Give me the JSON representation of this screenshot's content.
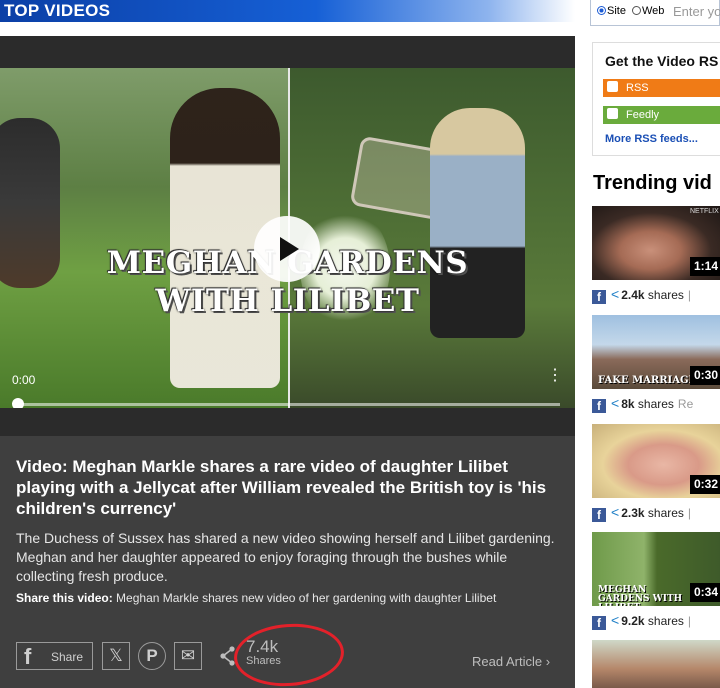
{
  "header": {
    "title": "TOP VIDEOS"
  },
  "player": {
    "overlay_line1": "MEGHAN GARDENS",
    "overlay_line2": "WITH LILIBET",
    "time": "0:00",
    "progress_fraction": 0
  },
  "video_info": {
    "title": "Video: Meghan Markle shares a rare video of daughter Lilibet playing with a Jellycat after William revealed the British toy is 'his children's currency'",
    "description": "The Duchess of Sussex has shared a new video showing herself and Lilibet gardening. Meghan and her daughter appeared to enjoy foraging through the bushes while collecting fresh produce.",
    "share_label": "Share this video:",
    "share_text": "Meghan Markle shares new video of her gardening with daughter Lilibet",
    "facebook_share_label": "Share",
    "share_count": "7.4k",
    "share_count_label": "Shares",
    "read_article": "Read Article ›"
  },
  "sidebar": {
    "search": {
      "option_site": "Site",
      "option_web": "Web",
      "placeholder": "Enter yo"
    },
    "rss": {
      "title": "Get the Video RS",
      "rss_label": "RSS",
      "feedly_label": "Feedly",
      "more_link": "More RSS feeds..."
    },
    "trending_title": "Trending vid",
    "trending": [
      {
        "duration": "1:14",
        "shares": "2.4k",
        "shares_label": "shares",
        "extra": "|",
        "thumb_text": "NETFLIX"
      },
      {
        "duration": "0:30",
        "shares": "8k",
        "shares_label": "shares",
        "extra": "Re",
        "thumb_text": "FAKE MARRIAGE"
      },
      {
        "duration": "0:32",
        "shares": "2.3k",
        "shares_label": "shares",
        "extra": "|",
        "thumb_text": ""
      },
      {
        "duration": "0:34",
        "shares": "9.2k",
        "shares_label": "shares",
        "extra": "|",
        "thumb_text": "MEGHAN GARDENS WITH LILIBET"
      }
    ]
  },
  "colors": {
    "header_blue": "#0b3fa6",
    "info_bg": "#3f3f3f",
    "rss_orange": "#f07b16",
    "feedly_green": "#6aab3c",
    "link_blue": "#1a4fb5",
    "annotation_red": "#e3212a"
  }
}
